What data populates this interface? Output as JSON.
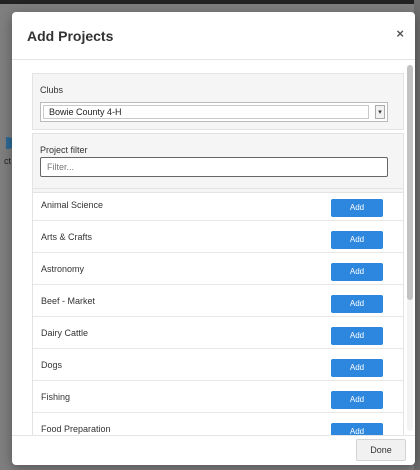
{
  "background": {
    "partial_text": "ct"
  },
  "modal": {
    "title": "Add Projects",
    "close_label": "×"
  },
  "clubs": {
    "label": "Clubs",
    "selected": "Bowie County 4-H",
    "caret": "▾"
  },
  "filter": {
    "label": "Project filter",
    "placeholder": "Filter..."
  },
  "projects": [
    {
      "name": "Animal Science",
      "button": "Add"
    },
    {
      "name": "Arts & Crafts",
      "button": "Add"
    },
    {
      "name": "Astronomy",
      "button": "Add"
    },
    {
      "name": "Beef - Market",
      "button": "Add"
    },
    {
      "name": "Dairy Cattle",
      "button": "Add"
    },
    {
      "name": "Dogs",
      "button": "Add"
    },
    {
      "name": "Fishing",
      "button": "Add"
    },
    {
      "name": "Food Preparation",
      "button": "Add"
    }
  ],
  "footer": {
    "done_label": "Done"
  },
  "colors": {
    "accent": "#2e87de",
    "overlay": "#7f7f7f"
  }
}
